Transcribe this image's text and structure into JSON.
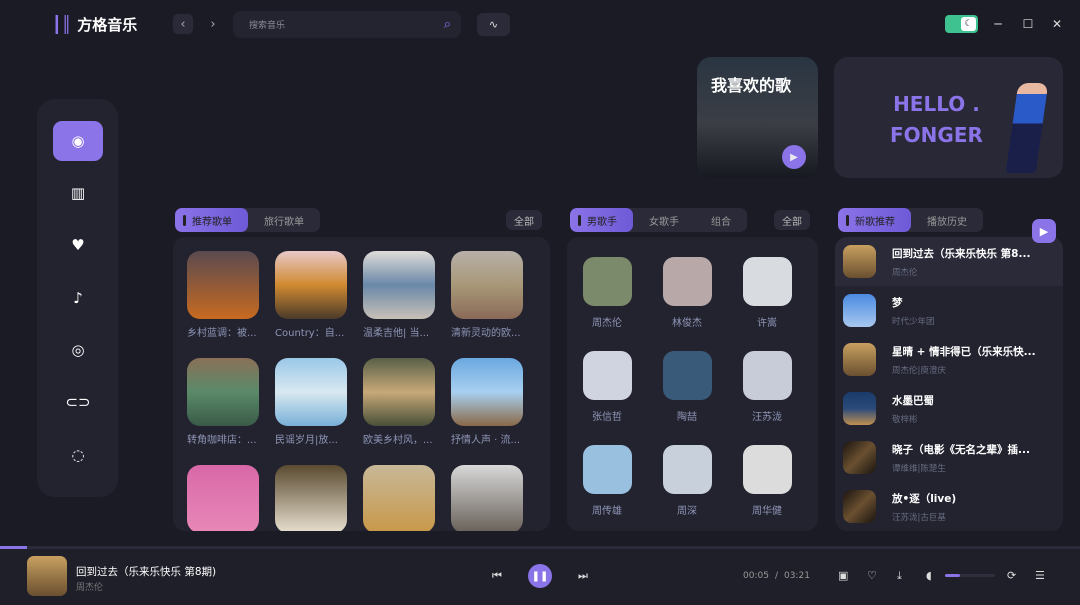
{
  "app": {
    "title": "方格音乐"
  },
  "search": {
    "placeholder": "搜索音乐"
  },
  "banners": {
    "favorites": "我喜欢的歌",
    "hello_line1": "HELLO .",
    "hello_line2": "FONGER"
  },
  "playlists": {
    "tabs": [
      "推荐歌单",
      "旅行歌单"
    ],
    "all_label": "全部",
    "items": [
      {
        "name": "乡村蓝调：被...",
        "color": "linear-gradient(180deg,#5a4a50,#c76a20)"
      },
      {
        "name": "Country：自...",
        "color": "linear-gradient(180deg,#e8c8c8,#d08a30,#4a3a2a)"
      },
      {
        "name": "温柔吉他| 当...",
        "color": "linear-gradient(180deg,#e0dcd8,#6a88a8,#c8c0b8)"
      },
      {
        "name": "清新灵动的欧...",
        "color": "linear-gradient(180deg,#b8b0a8,#a89878,#8a6a58)"
      },
      {
        "name": "转角咖啡店：...",
        "color": "linear-gradient(180deg,#8a7058,#5a8a6a,#3a5a48)"
      },
      {
        "name": "民谣岁月|放...",
        "color": "linear-gradient(180deg,#9ac8e8,#d8e8f0,#78b0d8)"
      },
      {
        "name": "欧美乡村风，...",
        "color": "linear-gradient(180deg,#586048,#c8a878,#485038)"
      },
      {
        "name": "抒情人声 · 流...",
        "color": "linear-gradient(180deg,#6aa8e0,#a8d0f0,#8a6848)"
      },
      {
        "name": "",
        "color": "linear-gradient(180deg,#d868a8,#e888b8)"
      },
      {
        "name": "",
        "color": "linear-gradient(180deg,#5a4a30,#e8e0d0)"
      },
      {
        "name": "",
        "color": "linear-gradient(180deg,#c8b898,#c89848)"
      },
      {
        "name": "",
        "color": "linear-gradient(180deg,#d8d8d8,#686058)"
      }
    ]
  },
  "singers": {
    "tabs": [
      "男歌手",
      "女歌手",
      "组合"
    ],
    "all_label": "全部",
    "items": [
      {
        "name": "周杰伦",
        "color": "#7a8a6a"
      },
      {
        "name": "林俊杰",
        "color": "#b8a8a8"
      },
      {
        "name": "许嵩",
        "color": "#d8dce0"
      },
      {
        "name": "张信哲",
        "color": "#d0d4e0"
      },
      {
        "name": "陶喆",
        "color": "#3a5a7a"
      },
      {
        "name": "汪苏泷",
        "color": "#c8ccd8"
      },
      {
        "name": "周传雄",
        "color": "#9ac0e0"
      },
      {
        "name": "周深",
        "color": "#c8d0dc"
      },
      {
        "name": "周华健",
        "color": "#dcdcdc"
      }
    ]
  },
  "songs": {
    "tabs": [
      "新歌推荐",
      "播放历史"
    ],
    "items": [
      {
        "title": "回到过去（乐来乐快乐 第8...",
        "artist": "周杰伦",
        "color": "linear-gradient(180deg,#c8a060,#6a5030)"
      },
      {
        "title": "梦",
        "artist": "时代少年团",
        "color": "linear-gradient(180deg,#4a8ae0,#a8c8f0)"
      },
      {
        "title": "星晴 + 情非得已（乐来乐快...",
        "artist": "周杰伦|庾澄庆",
        "color": "linear-gradient(180deg,#c8a060,#6a5030)"
      },
      {
        "title": "水墨巴蜀",
        "artist": "敬梓彬",
        "color": "linear-gradient(180deg,#1a3a6a,#2a4a7a,#c09050)"
      },
      {
        "title": "晓子（电影《无名之辈》插...",
        "artist": "谭维维|陈楚生",
        "color": "linear-gradient(135deg,#1a1410,#6a5030,#1a1410)"
      },
      {
        "title": "放•逐（live)",
        "artist": "汪苏泷|古巨基",
        "color": "linear-gradient(135deg,#1a1410,#6a5030,#1a1410)"
      }
    ]
  },
  "player": {
    "title": "回到过去（乐来乐快乐 第8期)",
    "artist": "周杰伦",
    "current": "00:05",
    "separator": "/",
    "total": "03:21",
    "progress": 0.025,
    "volume": 0.3
  },
  "colors": {
    "accent": "#8b73e8",
    "background": "#1b1b26",
    "panel": "#232330"
  }
}
